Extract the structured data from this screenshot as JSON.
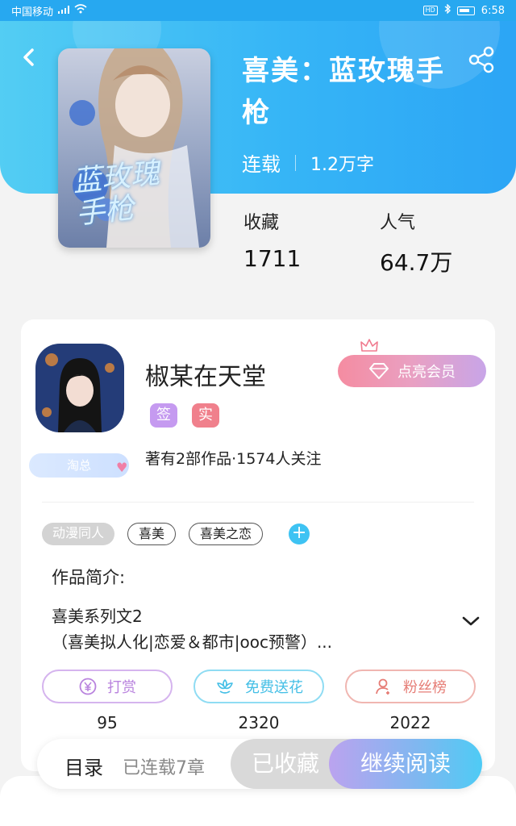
{
  "status_bar": {
    "carrier": "中国移动",
    "hd": "HD",
    "time": "6:58"
  },
  "book": {
    "title": "喜美：蓝玫瑰手枪",
    "status": "连载",
    "word_count": "1.2万字",
    "cover_text": "蓝玫瑰手枪",
    "stats": [
      {
        "label": "收藏",
        "value": "1711"
      },
      {
        "label": "人气",
        "value": "64.7万"
      }
    ]
  },
  "author": {
    "name": "椒某在天堂",
    "badges": [
      "签",
      "实"
    ],
    "badge_colors": [
      "#c59af0",
      "#f0808c"
    ],
    "level_badge": "淘总",
    "info": "著有2部作品·1574人关注",
    "vip_button": "点亮会员"
  },
  "tags": {
    "category": "动漫同人",
    "items": [
      "喜美",
      "喜美之恋"
    ],
    "add": "+"
  },
  "intro": {
    "label": "作品简介:",
    "line1": "喜美系列文2",
    "line2": "（喜美拟人化|恋爱＆都市|ooc预警）..."
  },
  "actions": [
    {
      "label": "打赏",
      "icon": "yen-coin-icon",
      "count": "95"
    },
    {
      "label": "免费送花",
      "icon": "flower-icon",
      "count": "2320"
    },
    {
      "label": "粉丝榜",
      "icon": "fan-user-icon",
      "count": "2022"
    }
  ],
  "bottom": {
    "toc": "目录",
    "chapters": "已连载7章",
    "collected": "已收藏",
    "continue": "继续阅读"
  },
  "colors": {
    "header_start": "#53cdf3",
    "header_end": "#2ca5f5",
    "vip_gradient_start": "#f58ca1",
    "vip_gradient_end": "#c8a5e8",
    "read_gradient_start": "#bba3ef",
    "read_gradient_end": "#4ecbf5"
  }
}
